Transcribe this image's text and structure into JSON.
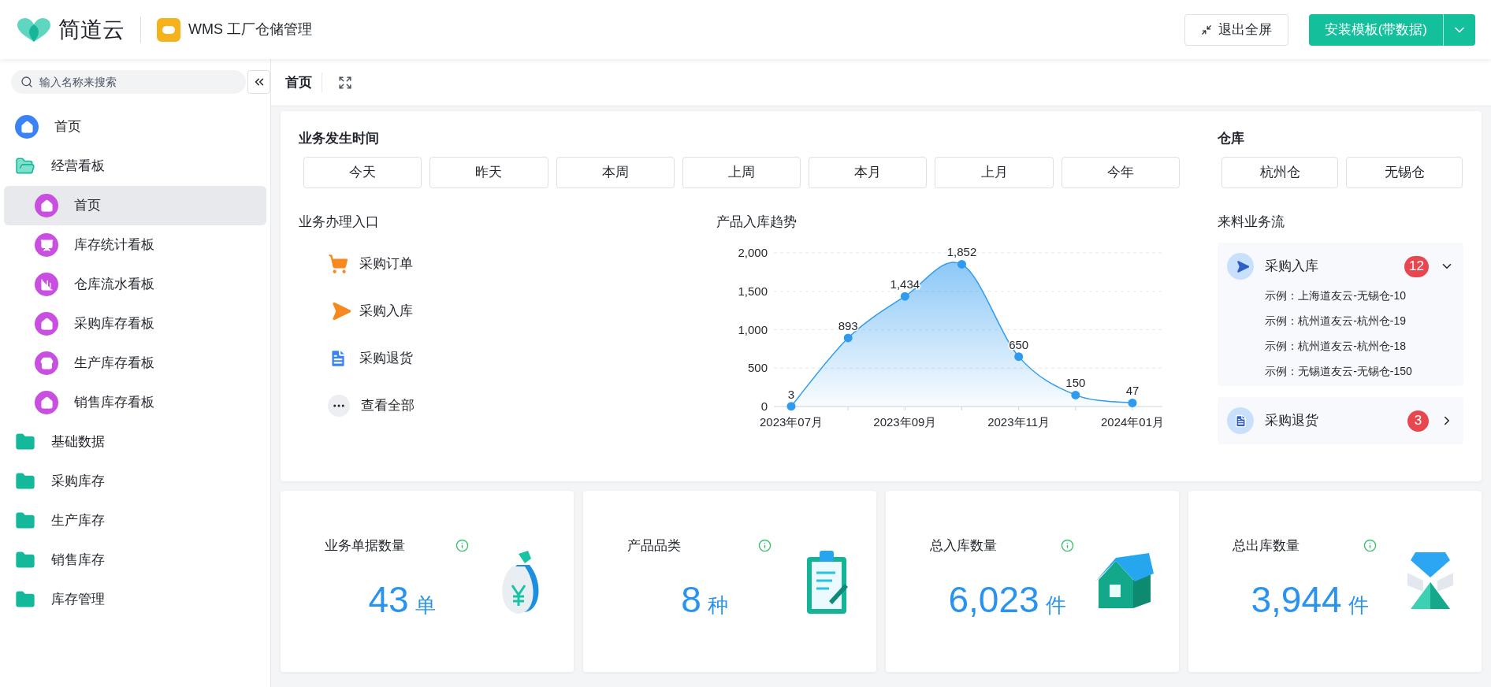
{
  "header": {
    "brand": "简道云",
    "app_title": "WMS 工厂仓储管理",
    "exit_fullscreen": "退出全屏",
    "install_button": "安装模板(带数据)"
  },
  "sidebar": {
    "search": {
      "placeholder": "输入名称来搜索"
    },
    "items": [
      {
        "label": "首页",
        "kind": "home",
        "selected": false
      },
      {
        "label": "经营看板",
        "kind": "folder",
        "selected": false,
        "expanded": true,
        "children": [
          {
            "label": "首页",
            "kind": "home",
            "selected": true
          },
          {
            "label": "库存统计看板",
            "kind": "screen",
            "selected": false
          },
          {
            "label": "仓库流水看板",
            "kind": "bars",
            "selected": false
          },
          {
            "label": "采购库存看板",
            "kind": "home",
            "selected": false
          },
          {
            "label": "生产库存看板",
            "kind": "store",
            "selected": false
          },
          {
            "label": "销售库存看板",
            "kind": "home",
            "selected": false
          }
        ]
      },
      {
        "label": "基础数据",
        "kind": "folder",
        "selected": false,
        "expanded": false
      },
      {
        "label": "采购库存",
        "kind": "folder",
        "selected": false,
        "expanded": false
      },
      {
        "label": "生产库存",
        "kind": "folder",
        "selected": false,
        "expanded": false
      },
      {
        "label": "销售库存",
        "kind": "folder",
        "selected": false,
        "expanded": false
      },
      {
        "label": "库存管理",
        "kind": "folder",
        "selected": false,
        "expanded": false
      }
    ]
  },
  "tabs": [
    {
      "label": "首页",
      "selected": true
    }
  ],
  "filters": {
    "time": {
      "title": "业务发生时间",
      "options": [
        {
          "label": "今天",
          "selected": false
        },
        {
          "label": "昨天",
          "selected": false
        },
        {
          "label": "本周",
          "selected": false
        },
        {
          "label": "上周",
          "selected": false
        },
        {
          "label": "本月",
          "selected": false
        },
        {
          "label": "上月",
          "selected": false
        },
        {
          "label": "今年",
          "selected": false
        }
      ]
    },
    "warehouse": {
      "title": "仓库",
      "options": [
        {
          "label": "杭州仓",
          "selected": false
        },
        {
          "label": "无锡仓",
          "selected": false
        }
      ]
    }
  },
  "entries": {
    "title": "业务办理入口",
    "items": [
      {
        "label": "采购订单",
        "kind": "cart"
      },
      {
        "label": "采购入库",
        "kind": "send"
      },
      {
        "label": "采购退货",
        "kind": "doc"
      },
      {
        "label": "查看全部",
        "kind": "more"
      }
    ]
  },
  "trend": {
    "title": "产品入库趋势",
    "chart_data": {
      "type": "area",
      "categories": [
        "2023年07月",
        null,
        "2023年09月",
        null,
        "2023年11月",
        null,
        "2024年01月"
      ],
      "series": [
        {
          "color": "#2f9bf0",
          "values": [
            3,
            893,
            1434,
            1852,
            650,
            150,
            47
          ]
        }
      ],
      "value_labels": [
        "3",
        "893",
        "1,434",
        "1,852",
        "650",
        "150",
        "47"
      ],
      "yticks": [
        {
          "value": 0,
          "label": "0"
        },
        {
          "value": 500,
          "label": "500"
        },
        {
          "value": 1000,
          "label": "1,000"
        },
        {
          "value": 1500,
          "label": "1,500"
        },
        {
          "value": 2000,
          "label": "2,000"
        }
      ],
      "ylim": [
        0,
        2000
      ],
      "grid": true
    }
  },
  "flow": {
    "title": "来料业务流",
    "groups": [
      {
        "label": "采购入库",
        "kind": "send",
        "count": "12",
        "expanded": true,
        "items": [
          "示例：上海道友云-无锡仓-10",
          "示例：杭州道友云-杭州仓-19",
          "示例：杭州道友云-杭州仓-18",
          "示例：无锡道友云-无锡仓-150"
        ]
      },
      {
        "label": "采购退货",
        "kind": "doc",
        "count": "3",
        "expanded": false
      }
    ]
  },
  "stats": [
    {
      "label": "业务单据数量",
      "value": "43",
      "unit": "单",
      "kind": "money"
    },
    {
      "label": "产品品类",
      "value": "8",
      "unit": "种",
      "kind": "clipboard"
    },
    {
      "label": "总入库数量",
      "value": "6,023",
      "unit": "件",
      "kind": "house"
    },
    {
      "label": "总出库数量",
      "value": "3,944",
      "unit": "件",
      "kind": "crystal"
    }
  ]
}
